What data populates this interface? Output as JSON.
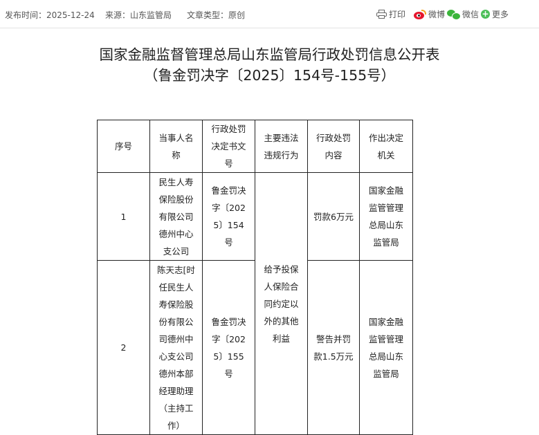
{
  "meta": {
    "publish_time": "发布时间：2025-12-24",
    "source": "来源：山东监管局",
    "article_type": "文章类型：原创"
  },
  "share": {
    "print": "打印",
    "weibo": "微博",
    "wechat": "微信",
    "more": "更多"
  },
  "title": {
    "line1": "国家金融监督管理总局山东监管局行政处罚信息公开表",
    "line2": "（鲁金罚决字〔2025〕154号-155号）"
  },
  "table": {
    "headers": {
      "seq": "序号",
      "party": "当事人名称",
      "doc_no": "行政处罚决定书文号",
      "violation": "主要违法违规行为",
      "content": "行政处罚内容",
      "authority": "作出决定机关"
    },
    "rows": [
      {
        "seq": "1",
        "party": "民生人寿保险股份有限公司德州中心支公司",
        "doc_no": "鲁金罚决字〔2025〕154号",
        "content": "罚款6万元",
        "authority": "国家金融监管管理总局山东监管局"
      },
      {
        "seq": "2",
        "party": "陈天志[时任民生人寿保险股份有限公司德州中心支公司德州本部经理助理（主持工作）",
        "doc_no": "鲁金罚决字〔2025〕155号",
        "content": "警告并罚款1.5万元",
        "authority": "国家金融监管管理总局山东监管局"
      }
    ],
    "shared_violation": "给予投保人保险合同约定以外的其他利益"
  }
}
